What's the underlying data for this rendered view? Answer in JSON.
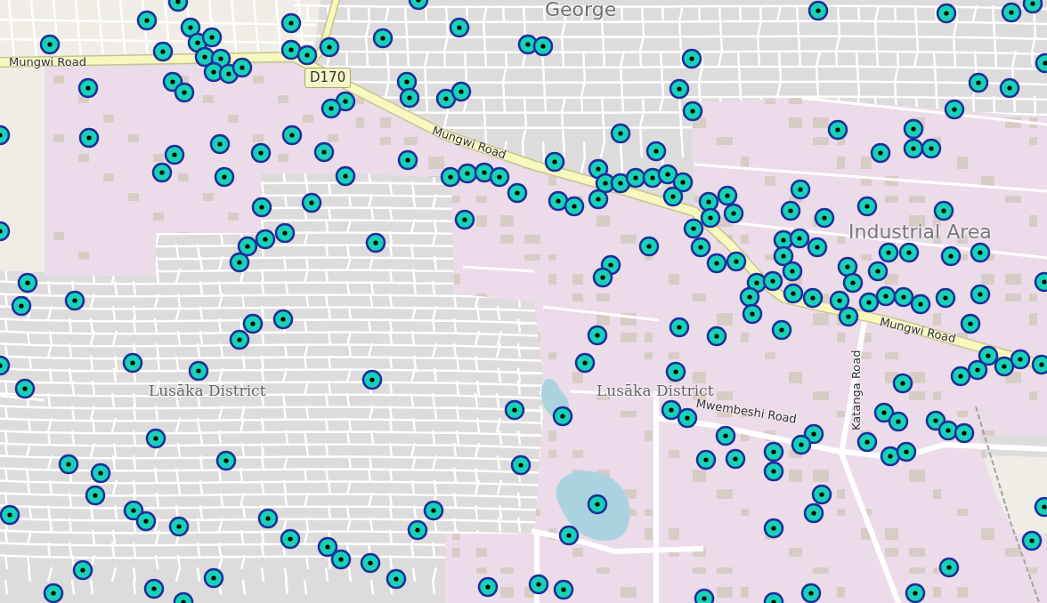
{
  "map": {
    "labels": [
      {
        "kind": "place",
        "text": "George"
      },
      {
        "kind": "road",
        "text": "Mungwi Road"
      },
      {
        "kind": "shield",
        "text": "D170"
      },
      {
        "kind": "road",
        "text": "Mungwi Road"
      },
      {
        "kind": "area",
        "text": "Industrial Area"
      },
      {
        "kind": "district",
        "text": "Lusāka District"
      },
      {
        "kind": "district",
        "text": "Lusāka District"
      },
      {
        "kind": "road",
        "text": "Mungwi Road"
      },
      {
        "kind": "road",
        "text": "Katanga Road"
      },
      {
        "kind": "road",
        "text": "Mwembeshi Road"
      }
    ]
  }
}
